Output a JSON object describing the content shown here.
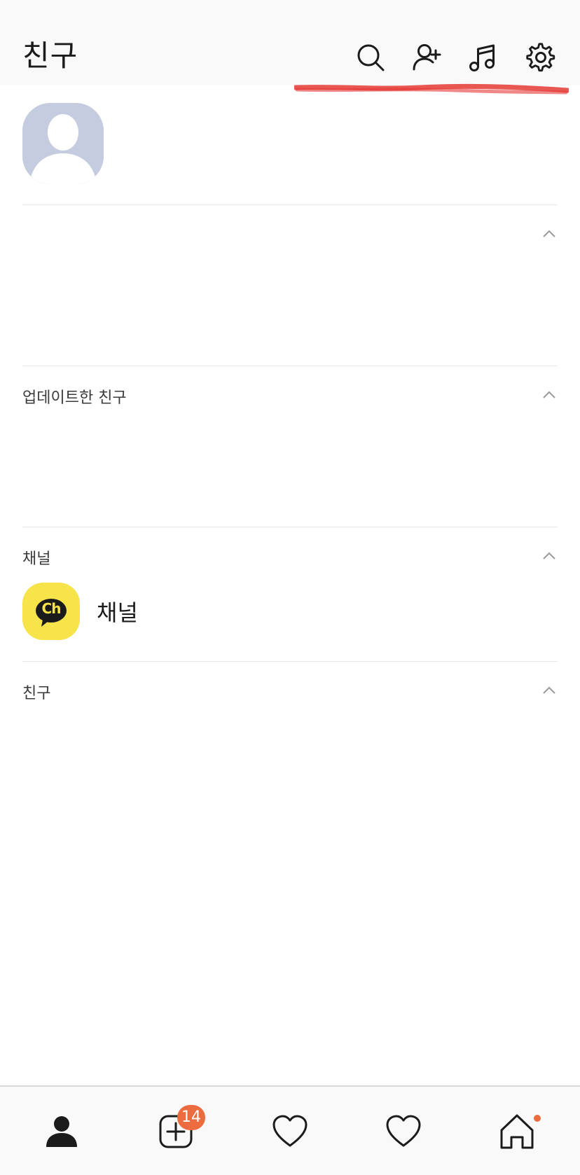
{
  "header": {
    "title": "친구",
    "icons": [
      "search-icon",
      "add-friend-icon",
      "music-icon",
      "settings-icon"
    ]
  },
  "profile": {
    "name": ""
  },
  "sections": {
    "updated_friends": {
      "title": "업데이트한 친구"
    },
    "channel": {
      "title": "채널",
      "item_label": "채널",
      "icon_text": "Ch"
    },
    "friends": {
      "title": "친구"
    }
  },
  "bottom_nav": {
    "items": [
      {
        "name": "friends-tab",
        "icon": "person-icon"
      },
      {
        "name": "chats-tab",
        "icon": "plus-square-icon",
        "badge": "14"
      },
      {
        "name": "favorites-tab",
        "icon": "heart-icon"
      },
      {
        "name": "favorites-tab-2",
        "icon": "heart-icon"
      },
      {
        "name": "home-tab",
        "icon": "home-icon",
        "dot": true
      }
    ]
  },
  "colors": {
    "accent": "#ec6b3f",
    "channel_yellow": "#f7e34a",
    "annotation_red": "#e53935",
    "avatar_bg": "#c6ccdf"
  }
}
